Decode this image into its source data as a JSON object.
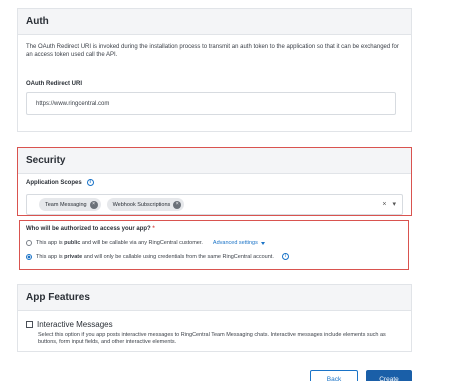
{
  "auth": {
    "title": "Auth",
    "description": "The OAuth Redirect URI is invoked during the installation process to transmit an auth token to the application so that it can be exchanged for an access token used call the API.",
    "redirect_label": "OAuth Redirect URI",
    "redirect_value": "https://www.ringcentral.com"
  },
  "security": {
    "title": "Security",
    "scopes_label": "Application Scopes",
    "scopes": [
      {
        "label": "Team Messaging"
      },
      {
        "label": "Webhook Subscriptions"
      }
    ],
    "clear_glyph": "×",
    "dropdown_glyph": "▾"
  },
  "authorization": {
    "question": "Who will be authorized to access your app?",
    "required_mark": "*",
    "option_public_pre": "This app is ",
    "option_public_bold": "public",
    "option_public_post": " and will be callable via any RingCentral customer.",
    "advanced_settings": "Advanced settings",
    "option_private_pre": "This app is ",
    "option_private_bold": "private",
    "option_private_post": " and will only be callable using credentials from the same RingCentral account.",
    "selected": "private"
  },
  "features": {
    "title": "App Features",
    "interactive_label": "Interactive Messages",
    "interactive_desc": "Select this option if you app posts interactive messages to RingCentral Team Messaging chats. Interactive messages include elements such as buttons, form input fields, and other interactive elements.",
    "interactive_checked": false
  },
  "footer": {
    "back_label": "Back",
    "create_label": "Create"
  },
  "colors": {
    "accent": "#1a73c7",
    "highlight_border": "#d9534f",
    "primary_button": "#1a5fa8"
  }
}
